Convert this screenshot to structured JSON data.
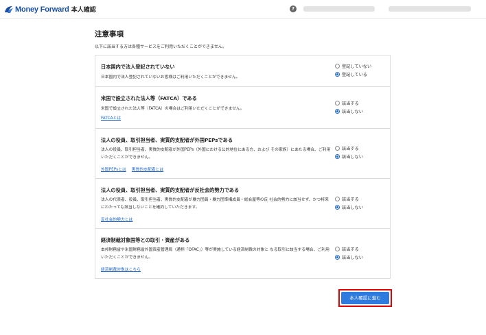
{
  "header": {
    "brand": "Money Forward",
    "page_label": "本人確認",
    "help_icon": "?"
  },
  "notice": {
    "title": "注意事項",
    "subtitle": "以下に該当する方は各種サービスをご利用いただくことができません。"
  },
  "items": [
    {
      "title": "日本国内で法人登記されていない",
      "desc": "日本国内で法人登記されていないお客様はご利用いただくことができません。",
      "links": [],
      "options": [
        {
          "label": "登記していない",
          "selected": false
        },
        {
          "label": "登記している",
          "selected": true
        }
      ]
    },
    {
      "title": "米国で設立された法人等（FATCA）である",
      "desc": "米国で設立された法人等（FATCA）の場合はご利用いただくことができません。",
      "links": [
        "FATCAとは"
      ],
      "options": [
        {
          "label": "該当する",
          "selected": false
        },
        {
          "label": "該当しない",
          "selected": true
        }
      ]
    },
    {
      "title": "法人の役員、取引担当者、実質的支配者が外国PEPsである",
      "desc": "法人の役員、取引担当者、実質的支配者が外国PEPs（外国における公的地位にある方、および その家族）にあたる場合、ご利用いただくことができません。",
      "links": [
        "外国PEPsとは",
        "実質的支配者とは"
      ],
      "options": [
        {
          "label": "該当する",
          "selected": false
        },
        {
          "label": "該当しない",
          "selected": true
        }
      ]
    },
    {
      "title": "法人の役員、取引担当者、実質的支配者が反社会的勢力である",
      "desc": "法人の代表者、役員、取引担当者、実質的支配者が暴力団員・暴力団準構成員・総会屋等の反 社会的勢力に該当せず、かつ将来にわたっても該当しないことを確約していただきます。",
      "links": [
        "反社会的勢力とは"
      ],
      "options": [
        {
          "label": "該当する",
          "selected": false
        },
        {
          "label": "該当しない",
          "selected": true
        }
      ]
    },
    {
      "title": "経済制裁対象国等との取引・資産がある",
      "desc": "本邦財務省や米国財務省外国資産管理局（通称「OFAC」）等が実施している経済制裁の対象と なる取引に該当する場合、ご利用いただくことができません。",
      "links": [
        "経済制裁対象はこちら"
      ],
      "options": [
        {
          "label": "該当する",
          "selected": false
        },
        {
          "label": "該当しない",
          "selected": true
        }
      ]
    }
  ],
  "submit": {
    "label": "本人確認に進む"
  },
  "colors": {
    "brand": "#1a4fa0",
    "link": "#1a66cc",
    "button": "#2e7be0",
    "highlight": "#e00000"
  }
}
